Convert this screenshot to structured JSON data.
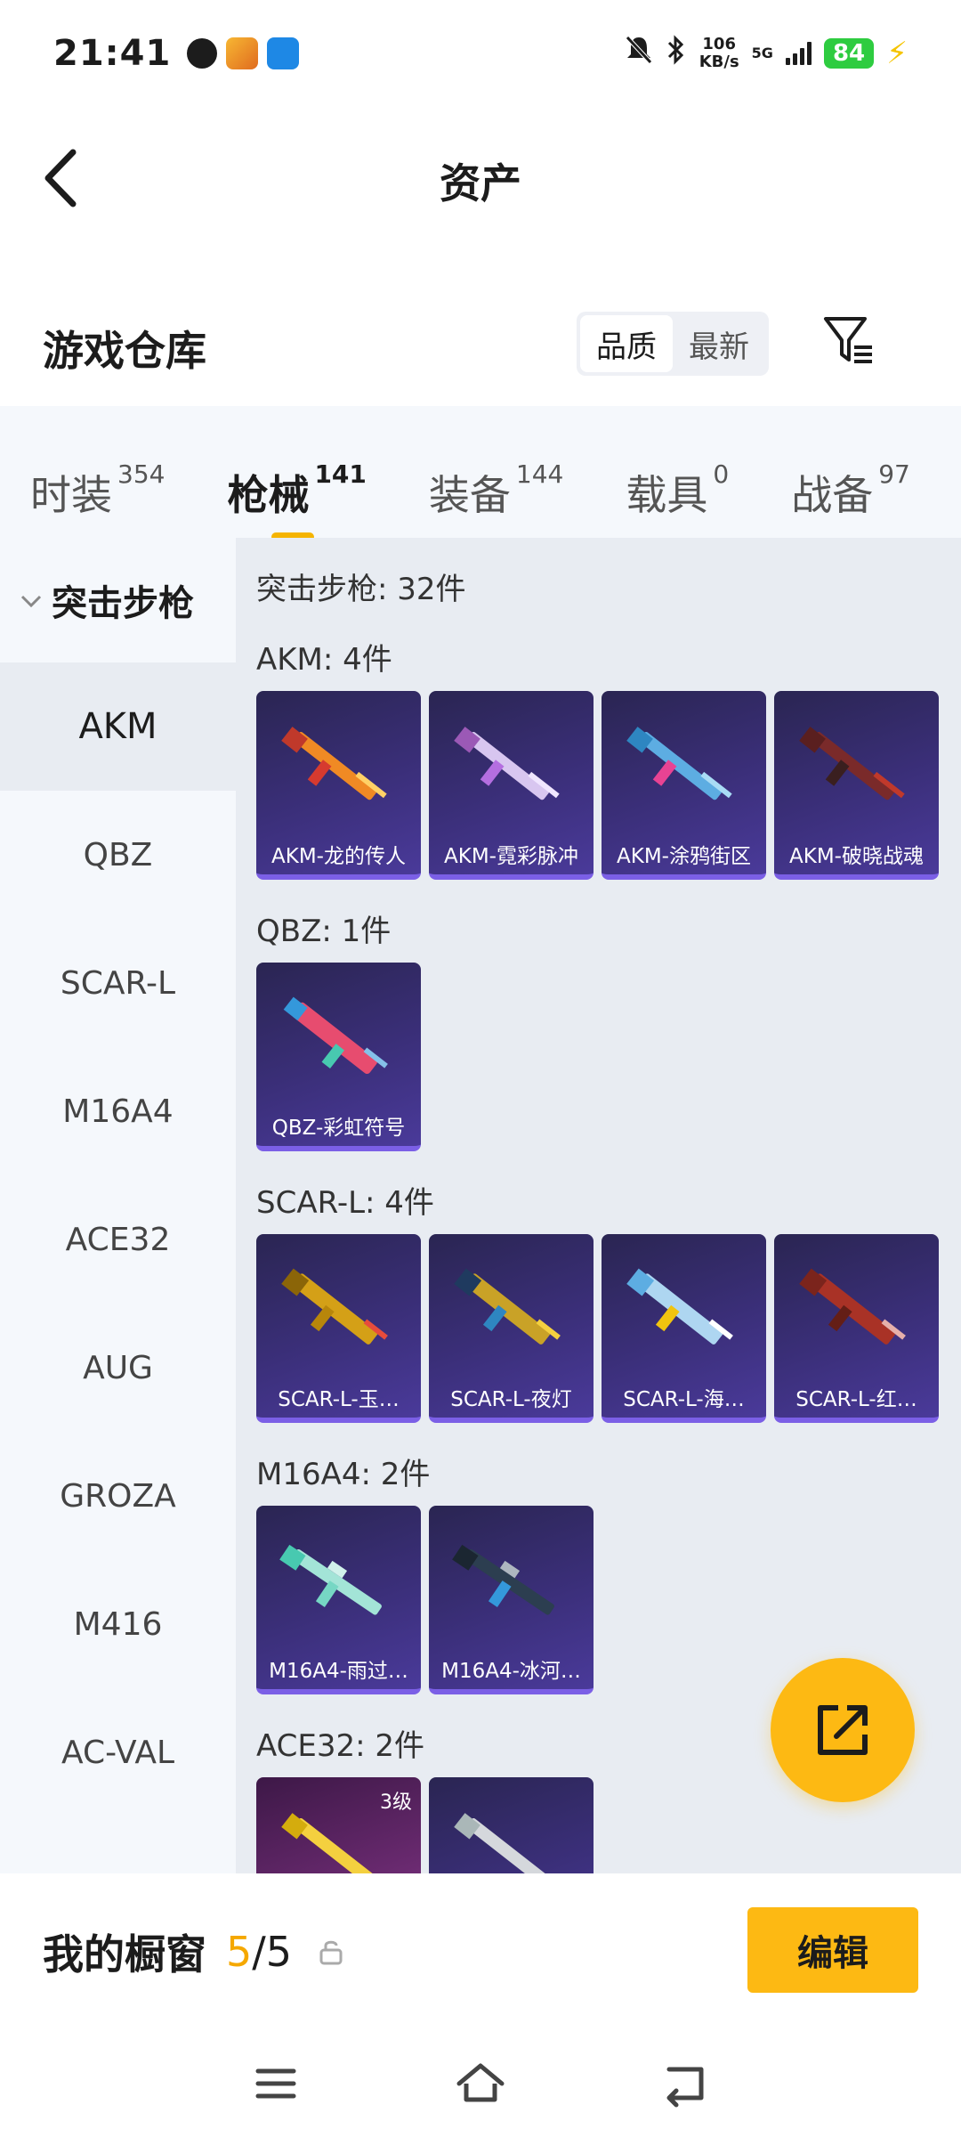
{
  "status_bar": {
    "time": "21:41",
    "speed_value": "106",
    "speed_unit": "KB/s",
    "network": "5G",
    "battery": "84"
  },
  "header": {
    "title": "资产"
  },
  "warehouse": {
    "title": "游戏仓库",
    "sort_options": [
      "品质",
      "最新"
    ],
    "active_sort": "品质"
  },
  "tabs": [
    {
      "label": "时装",
      "count": "354"
    },
    {
      "label": "枪械",
      "count": "141"
    },
    {
      "label": "装备",
      "count": "144"
    },
    {
      "label": "载具",
      "count": "0"
    },
    {
      "label": "战备",
      "count": "97"
    }
  ],
  "sidebar": {
    "category": "突击步枪",
    "items": [
      "AKM",
      "QBZ",
      "SCAR-L",
      "M16A4",
      "ACE32",
      "AUG",
      "GROZA",
      "M416",
      "AC-VAL"
    ],
    "active_item": "AKM"
  },
  "main": {
    "summary": "突击步枪: 32件",
    "groups": [
      {
        "title": "AKM: 4件",
        "items": [
          "AKM-龙的传人",
          "AKM-霓彩脉冲",
          "AKM-涂鸦街区",
          "AKM-破晓战魂"
        ]
      },
      {
        "title": "QBZ: 1件",
        "items": [
          "QBZ-彩虹符号"
        ]
      },
      {
        "title": "SCAR-L: 4件",
        "items": [
          "SCAR-L-玉…",
          "SCAR-L-夜灯",
          "SCAR-L-海…",
          "SCAR-L-红…"
        ]
      },
      {
        "title": "M16A4: 2件",
        "items": [
          "M16A4-雨过…",
          "M16A4-冰河…"
        ]
      },
      {
        "title": "ACE32: 2件",
        "items": [
          "3级",
          ""
        ]
      }
    ]
  },
  "showcase": {
    "title": "我的橱窗",
    "current": "5",
    "total": "/5",
    "edit_label": "编辑"
  },
  "colors": {
    "accent": "#fdb913",
    "card_bg": "#3b2f7a",
    "tab_underline": "#f5b400"
  }
}
